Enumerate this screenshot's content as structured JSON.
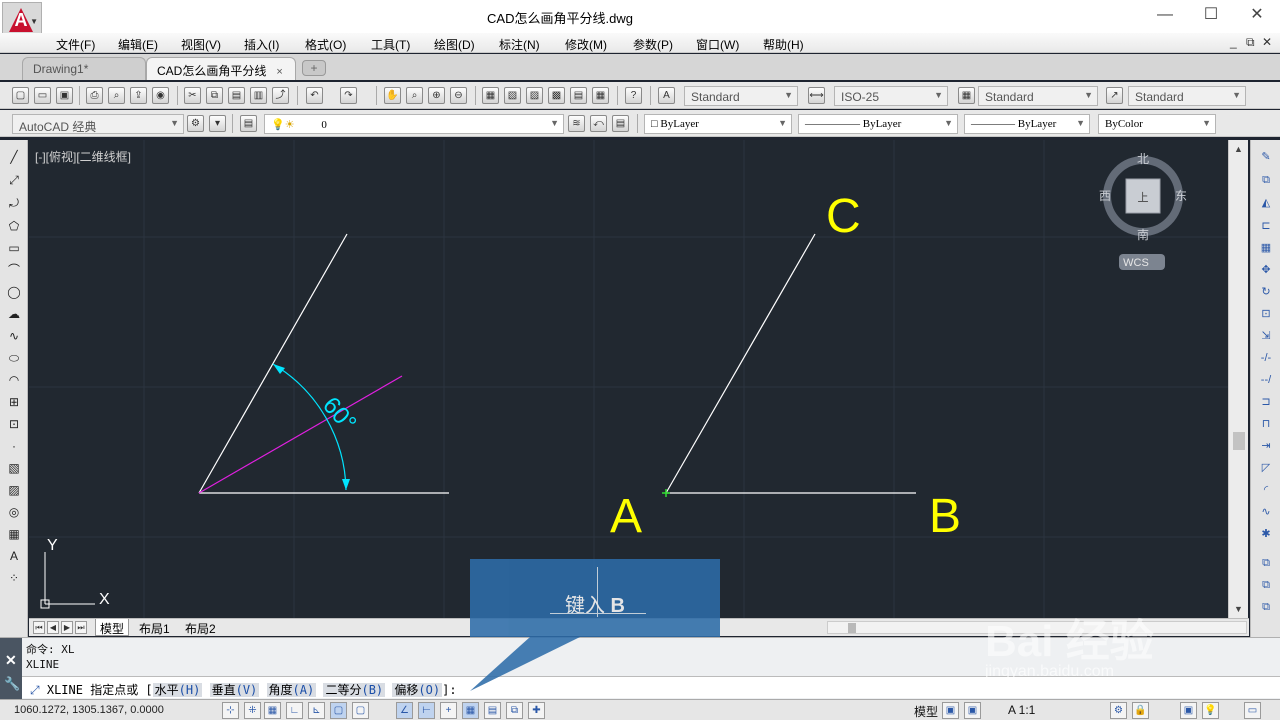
{
  "window": {
    "title": "CAD怎么画角平分线.dwg",
    "minimize": "—",
    "maximize": "☐",
    "close": "✕"
  },
  "menu": {
    "items": [
      "文件(F)",
      "编辑(E)",
      "视图(V)",
      "插入(I)",
      "格式(O)",
      "工具(T)",
      "绘图(D)",
      "标注(N)",
      "修改(M)",
      "参数(P)",
      "窗口(W)",
      "帮助(H)"
    ],
    "doc_controls": [
      "_",
      "⧉",
      "✕"
    ]
  },
  "tabs": [
    {
      "label": "Drawing1*",
      "active": false
    },
    {
      "label": "CAD怎么画角平分线",
      "active": true
    }
  ],
  "tab_close": "×",
  "new_tab": "+",
  "toolbar": {
    "text_style": "Standard",
    "dim_style": "ISO-25",
    "table_style": "Standard",
    "mleader_style": "Standard",
    "workspace": "AutoCAD 经典",
    "layer": "0",
    "color": "ByLayer",
    "linetype": "ByLayer",
    "lineweight": "ByLayer",
    "plotstyle": "ByColor"
  },
  "viewport": {
    "label": "[-][俯视][二维线框]"
  },
  "drawing": {
    "angle_label": "60°",
    "point_labels": [
      "A",
      "B",
      "C"
    ],
    "compass": {
      "north": "北",
      "south": "南",
      "east": "东",
      "west": "西",
      "wcs": "WCS",
      "top": "上"
    },
    "ucs": {
      "x": "X",
      "y": "Y"
    }
  },
  "layout_tabs": [
    "模型",
    "布局1",
    "布局2"
  ],
  "command": {
    "history": [
      "命令: XL",
      "XLINE"
    ],
    "prompt_prefix": "XLINE 指定点或 [",
    "options": [
      {
        "label": "水平",
        "key": "(H)"
      },
      {
        "label": "垂直",
        "key": "(V)"
      },
      {
        "label": "角度",
        "key": "(A)"
      },
      {
        "label": "二等分",
        "key": "(B)"
      },
      {
        "label": "偏移",
        "key": "(O)"
      }
    ],
    "prompt_suffix": "]:"
  },
  "status": {
    "coords": "1060.1272, 1305.1367, 0.0000",
    "model": "模型",
    "annotation_scale": "A 1:1"
  },
  "overlay": {
    "hint_prefix": "键入",
    "hint_key": "B"
  },
  "watermark": {
    "main": "Bai 经验",
    "sub": "jingyan.baidu.com"
  },
  "colors": {
    "canvas": "#212830",
    "geometry": "#ffffff",
    "bisector": "#e020e0",
    "dimension": "#00e5ff",
    "labels": "#ffff00"
  }
}
